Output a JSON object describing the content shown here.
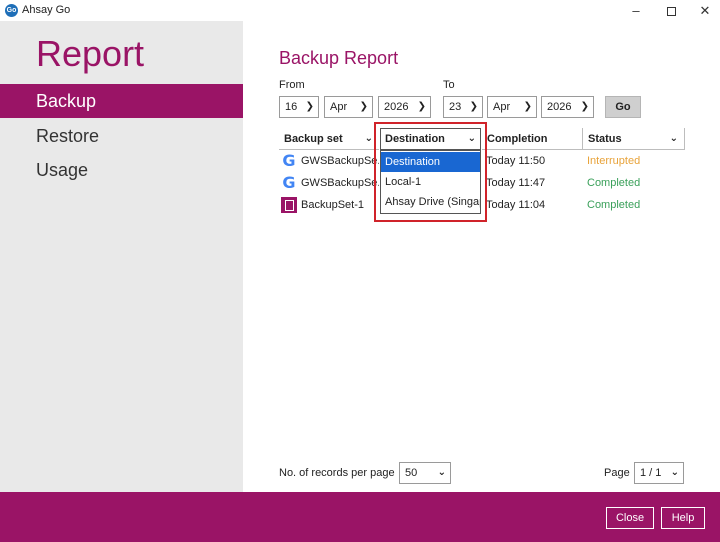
{
  "window": {
    "title": "Ahsay Go",
    "icon_text": "Go"
  },
  "sidebar": {
    "title": "Report",
    "items": [
      {
        "label": "Backup",
        "active": true
      },
      {
        "label": "Restore",
        "active": false
      },
      {
        "label": "Usage",
        "active": false
      }
    ]
  },
  "main": {
    "title": "Backup Report",
    "from_label": "From",
    "to_label": "To",
    "from": {
      "day": "16",
      "month": "Apr",
      "year": "2026"
    },
    "to": {
      "day": "23",
      "month": "Apr",
      "year": "2026"
    },
    "go_label": "Go"
  },
  "table": {
    "columns": [
      "Backup set",
      "Destination",
      "Completion",
      "Status"
    ],
    "rows": [
      {
        "backup_set": "GWSBackupSe...",
        "icon": "google-icon",
        "completion": "Today 11:50",
        "status": "Interrupted"
      },
      {
        "backup_set": "GWSBackupSe...",
        "icon": "google-icon",
        "completion": "Today 11:47",
        "status": "Completed"
      },
      {
        "backup_set": "BackupSet-1",
        "icon": "file-icon",
        "completion": "Today 11:04",
        "status": "Completed"
      }
    ]
  },
  "destination_dropdown": {
    "header": "Destination",
    "options": [
      "Destination",
      "Local-1",
      "Ahsay Drive (Singap"
    ],
    "selected_index": 0
  },
  "pagination": {
    "records_label": "No. of records per page",
    "records_value": "50",
    "page_label": "Page",
    "page_value": "1 / 1"
  },
  "footer": {
    "close_label": "Close",
    "help_label": "Help"
  },
  "colors": {
    "brand": "#9a1466",
    "interrupted": "#e8a33a",
    "completed": "#3aa05a",
    "highlight": "#d0232a"
  }
}
